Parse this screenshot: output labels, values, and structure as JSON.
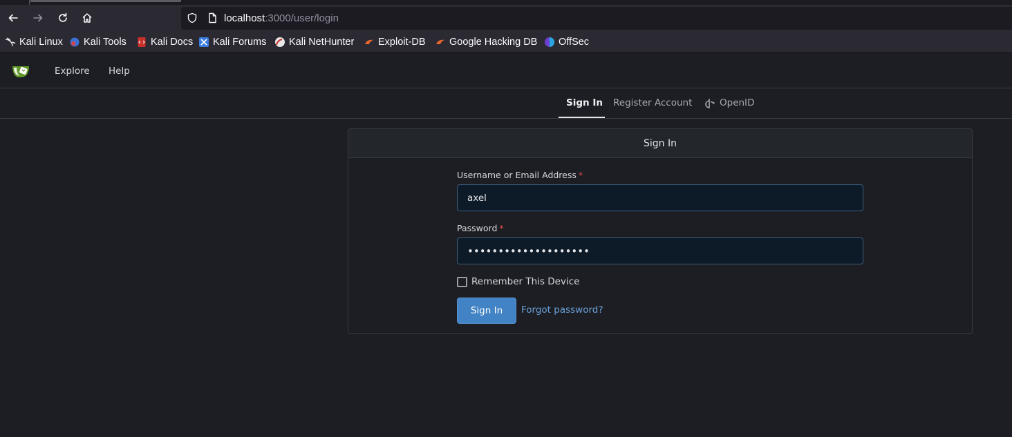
{
  "browser": {
    "url_host": "localhost",
    "url_rest": ":3000/user/login",
    "bookmarks": [
      {
        "label": "Kali Linux",
        "icon": "kali-dragon-icon"
      },
      {
        "label": "Kali Tools",
        "icon": "kali-tools-icon"
      },
      {
        "label": "Kali Docs",
        "icon": "kali-docs-icon"
      },
      {
        "label": "Kali Forums",
        "icon": "kali-forums-icon"
      },
      {
        "label": "Kali NetHunter",
        "icon": "kali-nethunter-icon"
      },
      {
        "label": "Exploit-DB",
        "icon": "exploit-db-icon"
      },
      {
        "label": "Google Hacking DB",
        "icon": "ghdb-icon"
      },
      {
        "label": "OffSec",
        "icon": "offsec-icon"
      }
    ]
  },
  "app": {
    "nav": {
      "explore": "Explore",
      "help": "Help"
    },
    "tabs": {
      "sign_in": "Sign In",
      "register": "Register Account",
      "openid": "OpenID"
    }
  },
  "form": {
    "title": "Sign In",
    "username_label": "Username or Email Address",
    "username_value": "axel",
    "password_label": "Password",
    "password_value": "••••••••••••••••••••",
    "required_mark": "*",
    "remember_label": "Remember This Device",
    "submit_label": "Sign In",
    "forgot_label": "Forgot password?"
  },
  "colors": {
    "accent": "#4183c4",
    "link": "#6ba1d9",
    "background": "#1c1e23",
    "required": "#db4a4a"
  }
}
